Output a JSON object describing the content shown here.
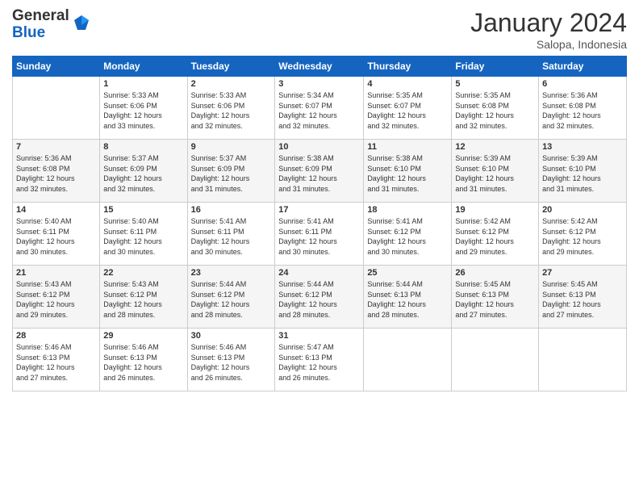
{
  "header": {
    "logo_line1": "General",
    "logo_line2": "Blue",
    "month": "January 2024",
    "location": "Salopa, Indonesia"
  },
  "days_of_week": [
    "Sunday",
    "Monday",
    "Tuesday",
    "Wednesday",
    "Thursday",
    "Friday",
    "Saturday"
  ],
  "weeks": [
    [
      {
        "day": "",
        "info": ""
      },
      {
        "day": "1",
        "info": "Sunrise: 5:33 AM\nSunset: 6:06 PM\nDaylight: 12 hours\nand 33 minutes."
      },
      {
        "day": "2",
        "info": "Sunrise: 5:33 AM\nSunset: 6:06 PM\nDaylight: 12 hours\nand 32 minutes."
      },
      {
        "day": "3",
        "info": "Sunrise: 5:34 AM\nSunset: 6:07 PM\nDaylight: 12 hours\nand 32 minutes."
      },
      {
        "day": "4",
        "info": "Sunrise: 5:35 AM\nSunset: 6:07 PM\nDaylight: 12 hours\nand 32 minutes."
      },
      {
        "day": "5",
        "info": "Sunrise: 5:35 AM\nSunset: 6:08 PM\nDaylight: 12 hours\nand 32 minutes."
      },
      {
        "day": "6",
        "info": "Sunrise: 5:36 AM\nSunset: 6:08 PM\nDaylight: 12 hours\nand 32 minutes."
      }
    ],
    [
      {
        "day": "7",
        "info": "Sunrise: 5:36 AM\nSunset: 6:08 PM\nDaylight: 12 hours\nand 32 minutes."
      },
      {
        "day": "8",
        "info": "Sunrise: 5:37 AM\nSunset: 6:09 PM\nDaylight: 12 hours\nand 32 minutes."
      },
      {
        "day": "9",
        "info": "Sunrise: 5:37 AM\nSunset: 6:09 PM\nDaylight: 12 hours\nand 31 minutes."
      },
      {
        "day": "10",
        "info": "Sunrise: 5:38 AM\nSunset: 6:09 PM\nDaylight: 12 hours\nand 31 minutes."
      },
      {
        "day": "11",
        "info": "Sunrise: 5:38 AM\nSunset: 6:10 PM\nDaylight: 12 hours\nand 31 minutes."
      },
      {
        "day": "12",
        "info": "Sunrise: 5:39 AM\nSunset: 6:10 PM\nDaylight: 12 hours\nand 31 minutes."
      },
      {
        "day": "13",
        "info": "Sunrise: 5:39 AM\nSunset: 6:10 PM\nDaylight: 12 hours\nand 31 minutes."
      }
    ],
    [
      {
        "day": "14",
        "info": "Sunrise: 5:40 AM\nSunset: 6:11 PM\nDaylight: 12 hours\nand 30 minutes."
      },
      {
        "day": "15",
        "info": "Sunrise: 5:40 AM\nSunset: 6:11 PM\nDaylight: 12 hours\nand 30 minutes."
      },
      {
        "day": "16",
        "info": "Sunrise: 5:41 AM\nSunset: 6:11 PM\nDaylight: 12 hours\nand 30 minutes."
      },
      {
        "day": "17",
        "info": "Sunrise: 5:41 AM\nSunset: 6:11 PM\nDaylight: 12 hours\nand 30 minutes."
      },
      {
        "day": "18",
        "info": "Sunrise: 5:41 AM\nSunset: 6:12 PM\nDaylight: 12 hours\nand 30 minutes."
      },
      {
        "day": "19",
        "info": "Sunrise: 5:42 AM\nSunset: 6:12 PM\nDaylight: 12 hours\nand 29 minutes."
      },
      {
        "day": "20",
        "info": "Sunrise: 5:42 AM\nSunset: 6:12 PM\nDaylight: 12 hours\nand 29 minutes."
      }
    ],
    [
      {
        "day": "21",
        "info": "Sunrise: 5:43 AM\nSunset: 6:12 PM\nDaylight: 12 hours\nand 29 minutes."
      },
      {
        "day": "22",
        "info": "Sunrise: 5:43 AM\nSunset: 6:12 PM\nDaylight: 12 hours\nand 28 minutes."
      },
      {
        "day": "23",
        "info": "Sunrise: 5:44 AM\nSunset: 6:12 PM\nDaylight: 12 hours\nand 28 minutes."
      },
      {
        "day": "24",
        "info": "Sunrise: 5:44 AM\nSunset: 6:12 PM\nDaylight: 12 hours\nand 28 minutes."
      },
      {
        "day": "25",
        "info": "Sunrise: 5:44 AM\nSunset: 6:13 PM\nDaylight: 12 hours\nand 28 minutes."
      },
      {
        "day": "26",
        "info": "Sunrise: 5:45 AM\nSunset: 6:13 PM\nDaylight: 12 hours\nand 27 minutes."
      },
      {
        "day": "27",
        "info": "Sunrise: 5:45 AM\nSunset: 6:13 PM\nDaylight: 12 hours\nand 27 minutes."
      }
    ],
    [
      {
        "day": "28",
        "info": "Sunrise: 5:46 AM\nSunset: 6:13 PM\nDaylight: 12 hours\nand 27 minutes."
      },
      {
        "day": "29",
        "info": "Sunrise: 5:46 AM\nSunset: 6:13 PM\nDaylight: 12 hours\nand 26 minutes."
      },
      {
        "day": "30",
        "info": "Sunrise: 5:46 AM\nSunset: 6:13 PM\nDaylight: 12 hours\nand 26 minutes."
      },
      {
        "day": "31",
        "info": "Sunrise: 5:47 AM\nSunset: 6:13 PM\nDaylight: 12 hours\nand 26 minutes."
      },
      {
        "day": "",
        "info": ""
      },
      {
        "day": "",
        "info": ""
      },
      {
        "day": "",
        "info": ""
      }
    ]
  ]
}
